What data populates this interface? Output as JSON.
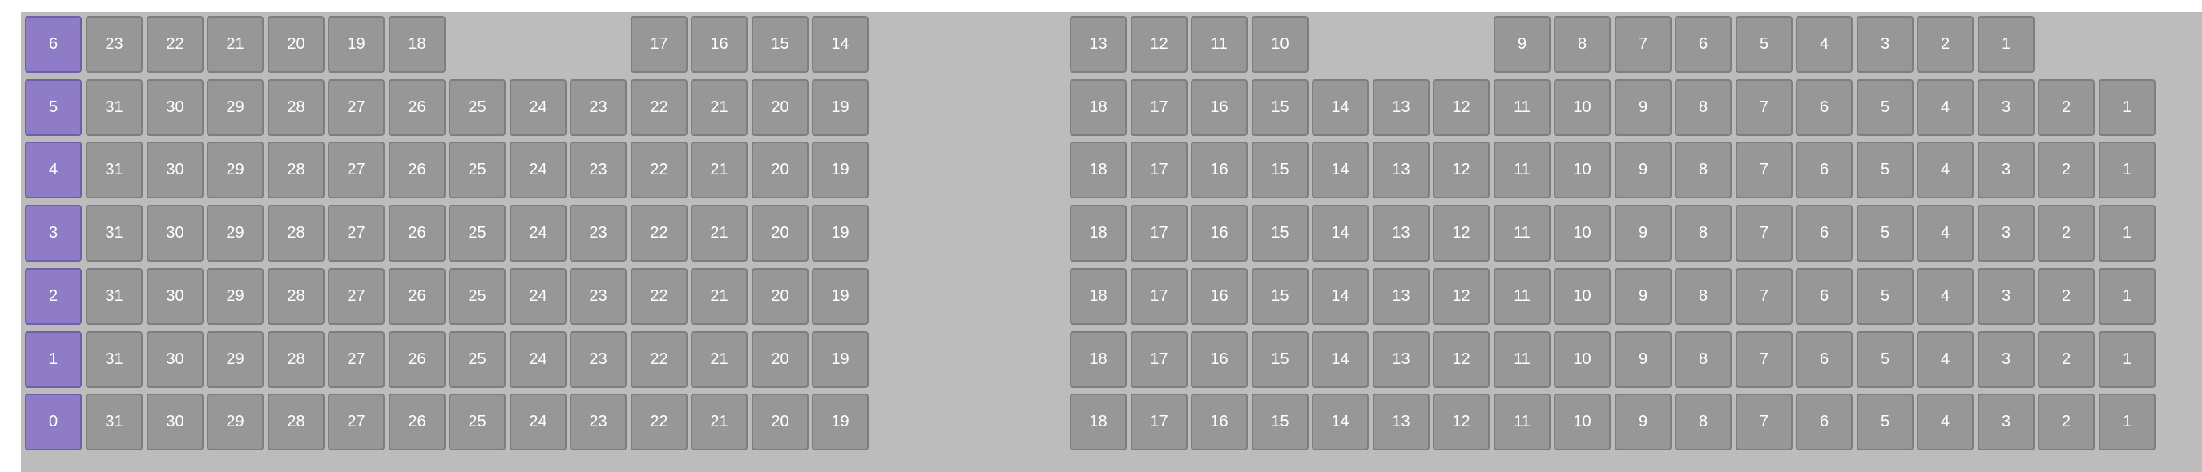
{
  "colors": {
    "panel_background": "#bcbcbc",
    "cell_background": "#979797",
    "row_label_background": "#8f7cc6"
  },
  "rows": [
    {
      "label": "6",
      "left_group": [
        "23",
        "22",
        "21",
        "20",
        "19",
        "18",
        "",
        "",
        "",
        "17",
        "16",
        "15",
        "14"
      ],
      "right_group": [
        "13",
        "12",
        "11",
        "10",
        "",
        "",
        "",
        "9",
        "8",
        "7",
        "6",
        "5",
        "4",
        "3",
        "2",
        "1",
        "",
        ""
      ]
    },
    {
      "label": "5",
      "left_group": [
        "31",
        "30",
        "29",
        "28",
        "27",
        "26",
        "25",
        "24",
        "23",
        "22",
        "21",
        "20",
        "19"
      ],
      "right_group": [
        "18",
        "17",
        "16",
        "15",
        "14",
        "13",
        "12",
        "11",
        "10",
        "9",
        "8",
        "7",
        "6",
        "5",
        "4",
        "3",
        "2",
        "1"
      ]
    },
    {
      "label": "4",
      "left_group": [
        "31",
        "30",
        "29",
        "28",
        "27",
        "26",
        "25",
        "24",
        "23",
        "22",
        "21",
        "20",
        "19"
      ],
      "right_group": [
        "18",
        "17",
        "16",
        "15",
        "14",
        "13",
        "12",
        "11",
        "10",
        "9",
        "8",
        "7",
        "6",
        "5",
        "4",
        "3",
        "2",
        "1"
      ]
    },
    {
      "label": "3",
      "left_group": [
        "31",
        "30",
        "29",
        "28",
        "27",
        "26",
        "25",
        "24",
        "23",
        "22",
        "21",
        "20",
        "19"
      ],
      "right_group": [
        "18",
        "17",
        "16",
        "15",
        "14",
        "13",
        "12",
        "11",
        "10",
        "9",
        "8",
        "7",
        "6",
        "5",
        "4",
        "3",
        "2",
        "1"
      ]
    },
    {
      "label": "2",
      "left_group": [
        "31",
        "30",
        "29",
        "28",
        "27",
        "26",
        "25",
        "24",
        "23",
        "22",
        "21",
        "20",
        "19"
      ],
      "right_group": [
        "18",
        "17",
        "16",
        "15",
        "14",
        "13",
        "12",
        "11",
        "10",
        "9",
        "8",
        "7",
        "6",
        "5",
        "4",
        "3",
        "2",
        "1"
      ]
    },
    {
      "label": "1",
      "left_group": [
        "31",
        "30",
        "29",
        "28",
        "27",
        "26",
        "25",
        "24",
        "23",
        "22",
        "21",
        "20",
        "19"
      ],
      "right_group": [
        "18",
        "17",
        "16",
        "15",
        "14",
        "13",
        "12",
        "11",
        "10",
        "9",
        "8",
        "7",
        "6",
        "5",
        "4",
        "3",
        "2",
        "1"
      ]
    },
    {
      "label": "0",
      "left_group": [
        "31",
        "30",
        "29",
        "28",
        "27",
        "26",
        "25",
        "24",
        "23",
        "22",
        "21",
        "20",
        "19"
      ],
      "right_group": [
        "18",
        "17",
        "16",
        "15",
        "14",
        "13",
        "12",
        "11",
        "10",
        "9",
        "8",
        "7",
        "6",
        "5",
        "4",
        "3",
        "2",
        "1"
      ]
    }
  ]
}
